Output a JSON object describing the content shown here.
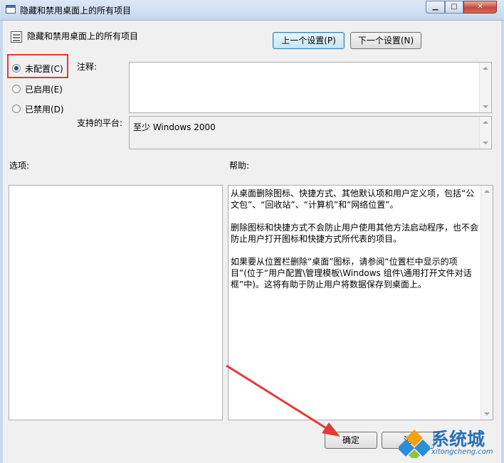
{
  "window": {
    "title": "隐藏和禁用桌面上的所有项目",
    "minimize_icon": "minimize-icon",
    "maximize_icon": "maximize-icon",
    "close_icon": "close-icon"
  },
  "header": {
    "policy_title": "隐藏和禁用桌面上的所有项目",
    "prev_button": "上一个设置(P)",
    "next_button": "下一个设置(N)"
  },
  "state_options": [
    {
      "label": "未配置(C)",
      "checked": true
    },
    {
      "label": "已启用(E)",
      "checked": false
    },
    {
      "label": "已禁用(D)",
      "checked": false
    }
  ],
  "comment": {
    "label": "注释:",
    "value": ""
  },
  "platform": {
    "label": "支持的平台:",
    "value": "至少 Windows 2000"
  },
  "options": {
    "label": "选项:"
  },
  "help": {
    "label": "帮助:",
    "paragraphs": [
      "从桌面删除图标、快捷方式、其他默认项和用户定义项，包括“公文包”、“回收站”、“计算机”和“网络位置”。",
      "删除图标和快捷方式不会防止用户使用其他方法启动程序，也不会防止用户打开图标和快捷方式所代表的项目。",
      "如果要从位置栏删除“桌面”图标，请参阅“位置栏中显示的项目”(位于“用户配置\\管理模板\\Windows 组件\\通用打开文件对话框”中)。这将有助于防止用户将数据保存到桌面上。"
    ]
  },
  "footer": {
    "ok_button": "确定",
    "cancel_button": "消"
  },
  "watermark": {
    "name": "系统城",
    "url": "xitongcheng.com"
  },
  "colors": {
    "highlight_box": "#e53935",
    "annotation_arrow": "#e53935",
    "watermark_blue": "#2a6fb6"
  }
}
